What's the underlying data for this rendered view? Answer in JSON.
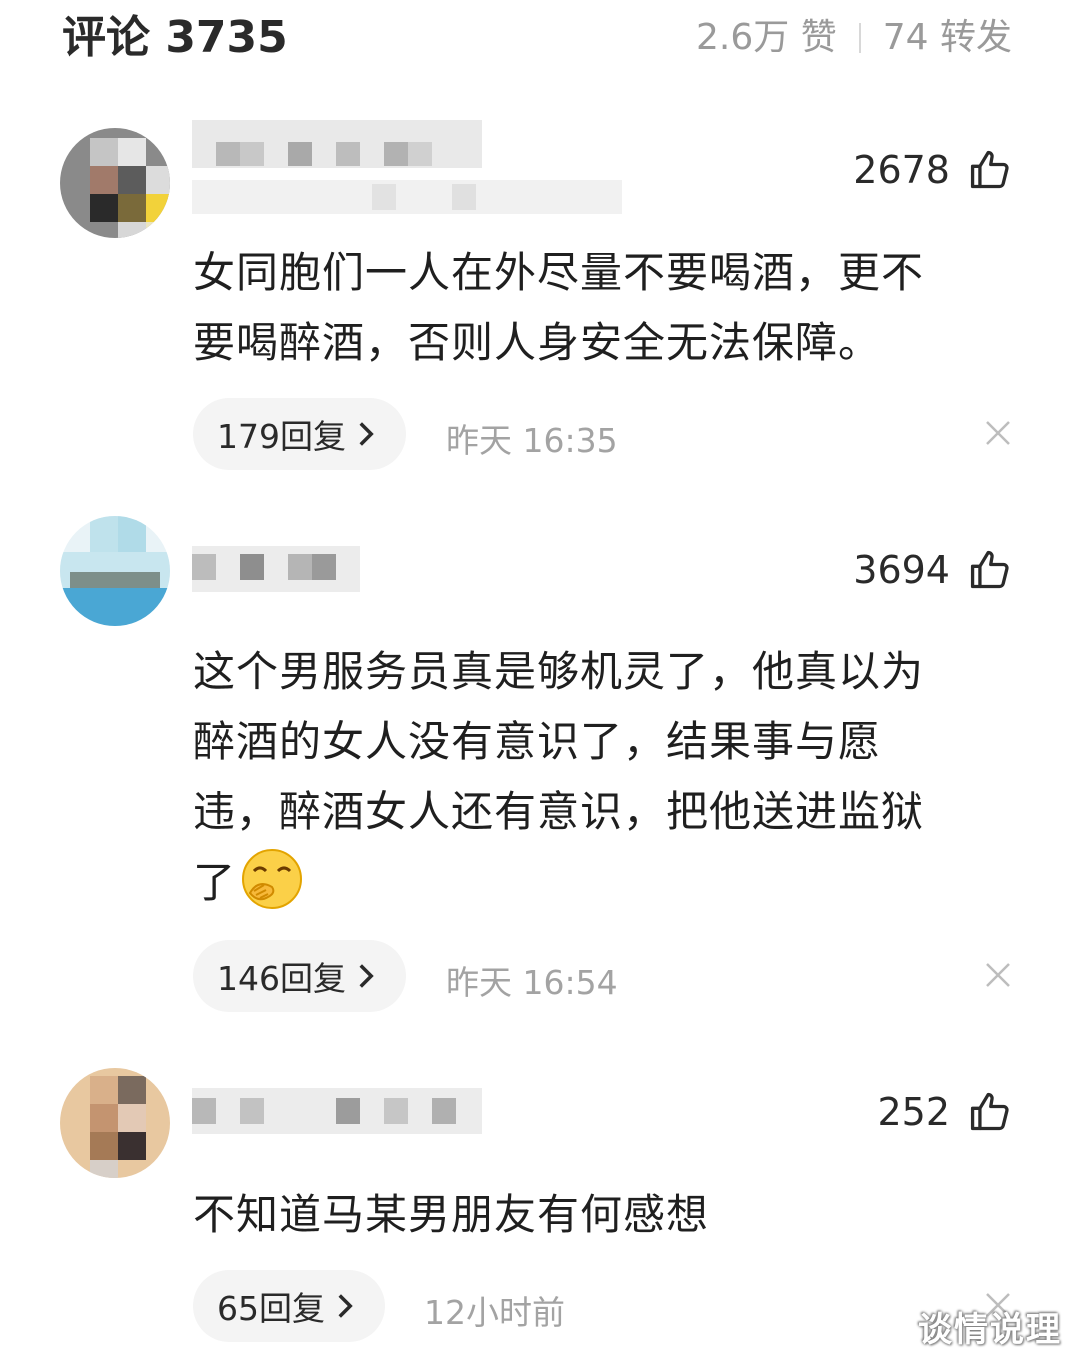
{
  "header": {
    "title": "评论 3735",
    "likes": "2.6万 赞",
    "shares": "74 转发"
  },
  "comments": [
    {
      "likes": "2678",
      "text_lines": [
        "女同胞们一人在外尽量不要喝酒，更不",
        "要喝醉酒，否则人身安全无法保障。"
      ],
      "reply_label": "179回复",
      "time": "昨天  16:35"
    },
    {
      "likes": "3694",
      "text_lines": [
        "这个男服务员真是够机灵了，他真以为",
        "醉酒的女人没有意识了，结果事与愿",
        "违，醉酒女人还有意识，把他送进监狱",
        "了"
      ],
      "reply_label": "146回复",
      "time": "昨天  16:54"
    },
    {
      "likes": "252",
      "text_lines": [
        "不知道马某男朋友有何感想"
      ],
      "reply_label": "65回复",
      "time": "12小时前"
    }
  ],
  "watermark": "谈情说理",
  "icons": {
    "like": "thumbs-up-icon",
    "close": "close-icon",
    "chevron": "chevron-right-icon",
    "emoji": "covering-mouth-emoji-icon"
  },
  "colors": {
    "text_primary": "#1f1f1f",
    "text_secondary": "#a3a3a3",
    "pill_bg": "#f4f4f4"
  }
}
